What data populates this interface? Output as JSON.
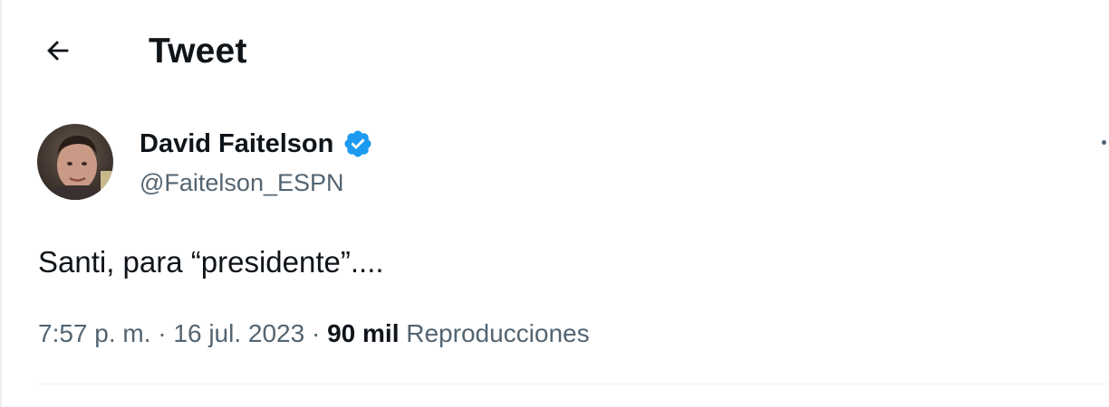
{
  "header": {
    "back_icon": "arrow-left-icon",
    "title": "Tweet"
  },
  "author": {
    "display_name": "David Faitelson",
    "handle": "@Faitelson_ESPN",
    "verified_icon": "verified-badge-icon",
    "verified_color": "#1d9bf0"
  },
  "tweet": {
    "text": "Santi, para “presidente”....",
    "time": "7:57 p. m.",
    "separator": "·",
    "date": "16 jul. 2023",
    "views_count": "90 mil",
    "views_label": "Reproducciones"
  },
  "more_icon": "more-options-icon"
}
